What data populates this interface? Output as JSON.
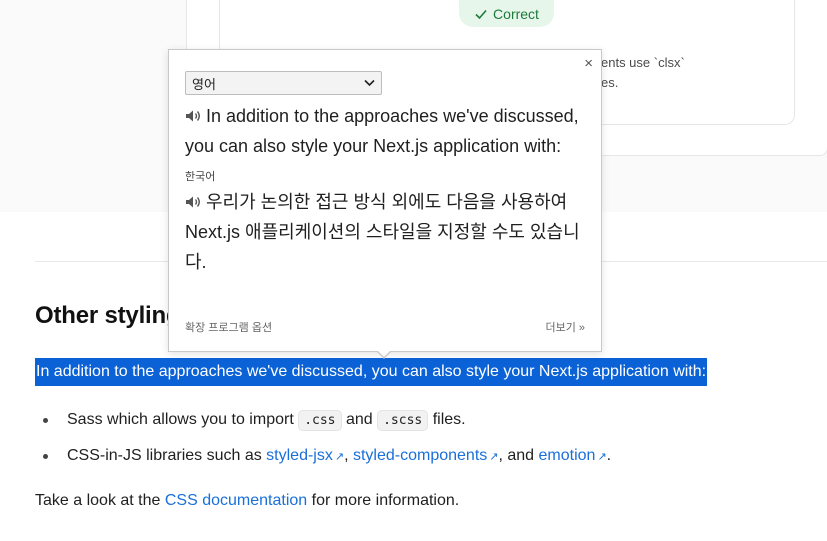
{
  "quiz": {
    "badge_label": "Correct",
    "explain_line1": "ents use `clsx`",
    "explain_line2": "es."
  },
  "article": {
    "heading": "Other styling",
    "selected_text": "In addition to the approaches we've discussed, you can also style your Next.js application with:",
    "list": [
      {
        "prefix": "Sass which allows you to import ",
        "code1": ".css",
        "mid": " and ",
        "code2": ".scss",
        "suffix": " files."
      },
      {
        "prefix": "CSS-in-JS libraries such as ",
        "link1": "styled-jsx",
        "sep1": ", ",
        "link2": "styled-components",
        "sep2": ", and ",
        "link3": "emotion",
        "suffix": "."
      }
    ],
    "para_prefix": "Take a look at the ",
    "para_link": "CSS documentation",
    "para_suffix": " for more information."
  },
  "popup": {
    "close_glyph": "×",
    "source_lang": "영어",
    "source_text": "In addition to the approaches we've discussed, you can also style your Next.js application with:",
    "target_lang": "한국어",
    "target_text": "우리가 논의한 접근 방식 외에도 다음을 사용하여 Next.js 애플리케이션의 스타일을 지정할 수도 있습니다.",
    "extension_options": "확장 프로그램 옵션",
    "more": "더보기 »"
  },
  "icons": {
    "check": "check-icon",
    "speaker": "speaker-icon",
    "external": "external-link-icon",
    "dropdown": "chevron-down-icon"
  },
  "colors": {
    "accent": "#0b62d6",
    "link": "#1a6fd8",
    "correct_bg": "#e6f6ea",
    "correct_text": "#1f7a3a"
  }
}
